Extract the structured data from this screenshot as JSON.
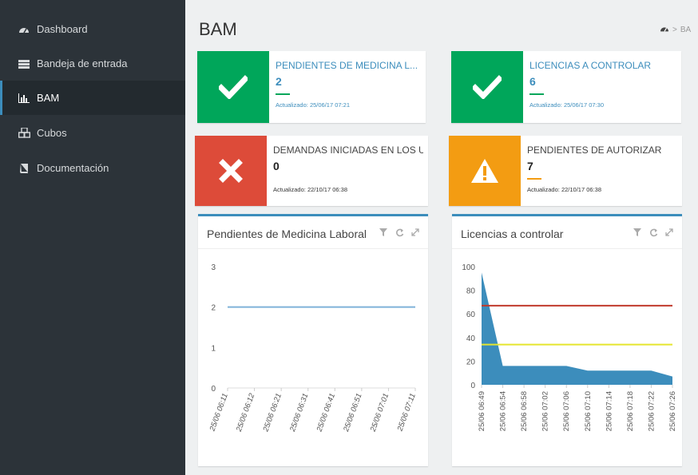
{
  "sidebar": {
    "items": [
      {
        "label": "Dashboard",
        "icon": "dashboard-icon"
      },
      {
        "label": "Bandeja de entrada",
        "icon": "inbox-icon"
      },
      {
        "label": "BAM",
        "icon": "bar-chart-icon",
        "active": true
      },
      {
        "label": "Cubos",
        "icon": "cubes-icon"
      },
      {
        "label": "Documentación",
        "icon": "book-icon"
      }
    ]
  },
  "header": {
    "title": "BAM",
    "breadcrumb": {
      "home_icon": "dashboard-icon",
      "separator": ">",
      "current": "BA"
    }
  },
  "info_boxes": [
    {
      "title": "PENDIENTES DE MEDICINA L...",
      "value": "2",
      "updated": "Actualizado: 25/06/17 07:21",
      "status": "success",
      "icon": "check-icon",
      "color": "#00a65a"
    },
    {
      "title": "LICENCIAS A CONTROLAR",
      "value": "6",
      "updated": "Actualizado: 25/06/17 07:30",
      "status": "success",
      "icon": "check-icon",
      "color": "#00a65a"
    },
    {
      "title": "DEMANDAS INICIADAS EN LOS ULTI",
      "value": "0",
      "updated": "Actualizado: 22/10/17 06:38",
      "status": "danger",
      "icon": "x-icon",
      "color": "#dd4b39"
    },
    {
      "title": "PENDIENTES DE AUTORIZAR",
      "value": "7",
      "updated": "Actualizado: 22/10/17 06:38",
      "status": "warning",
      "icon": "warning-icon",
      "color": "#f39c12"
    }
  ],
  "panels": [
    {
      "title": "Pendientes de Medicina Laboral",
      "tools": [
        "filter-icon",
        "refresh-icon",
        "expand-icon"
      ]
    },
    {
      "title": "Licencias a controlar",
      "tools": [
        "filter-icon",
        "refresh-icon",
        "expand-icon"
      ]
    }
  ],
  "chart_data": [
    {
      "type": "line",
      "title": "Pendientes de Medicina Laboral",
      "x": [
        "25/06 06:11",
        "25/06 06:12",
        "25/06 06:21",
        "25/06 06:31",
        "25/06 06:41",
        "25/06 06:51",
        "25/06 07:01",
        "25/06 07:11"
      ],
      "series": [
        {
          "values": [
            2,
            2,
            2,
            2,
            2,
            2,
            2,
            2
          ],
          "color": "#7fb2d9"
        }
      ],
      "yticks": [
        0,
        1,
        2,
        3
      ],
      "ylim": [
        0,
        3
      ],
      "grid": false
    },
    {
      "type": "area",
      "title": "Licencias a controlar",
      "x": [
        "25/06 06:49",
        "25/06 06:54",
        "25/06 06:58",
        "25/06 07:02",
        "25/06 07:06",
        "25/06 07:10",
        "25/06 07:14",
        "25/06 07:18",
        "25/06 07:22",
        "25/06 07:26"
      ],
      "series": [
        {
          "values": [
            95,
            16,
            16,
            16,
            16,
            12,
            12,
            12,
            12,
            7
          ],
          "color": "#3c8dbc"
        }
      ],
      "thresholds": [
        {
          "value": 67,
          "color": "#c0392b"
        },
        {
          "value": 34,
          "color": "#e5e52e"
        }
      ],
      "yticks": [
        0,
        20,
        40,
        60,
        80,
        100
      ],
      "ylim": [
        0,
        100
      ],
      "grid": false
    }
  ]
}
